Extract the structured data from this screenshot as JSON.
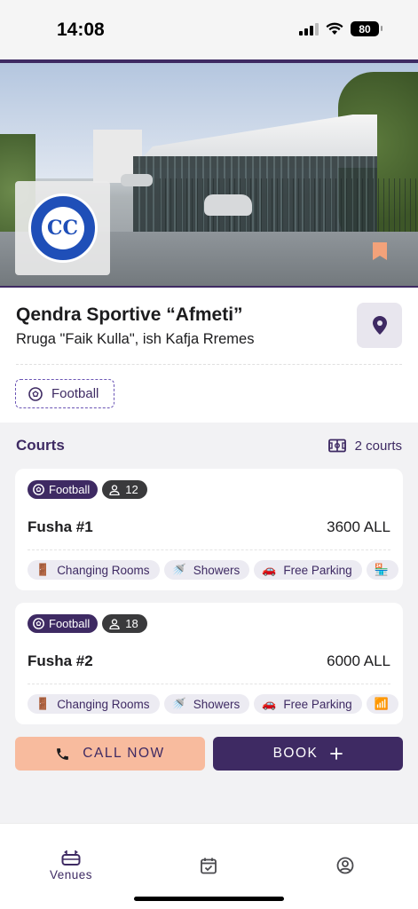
{
  "status_bar": {
    "time": "14:08",
    "battery": "80"
  },
  "venue": {
    "name": "Qendra Sportive “Afmeti”",
    "address": "Rruga \"Faik Kulla\", ish Kafja Rremes",
    "logo_text": "CC",
    "sport_chip": "Football"
  },
  "courts": {
    "title": "Courts",
    "count_label": "2 courts",
    "items": [
      {
        "sport": "Football",
        "players": "12",
        "name": "Fusha #1",
        "price": "3600 ALL",
        "amenities": [
          "Changing Rooms",
          "Showers",
          "Free Parking"
        ]
      },
      {
        "sport": "Football",
        "players": "18",
        "name": "Fusha #2",
        "price": "6000 ALL",
        "amenities": [
          "Changing Rooms",
          "Showers",
          "Free Parking"
        ]
      }
    ]
  },
  "actions": {
    "call_label": "CALL NOW",
    "book_label": "BOOK"
  },
  "nav": {
    "venues_label": "Venues"
  },
  "colors": {
    "primary": "#3e2a63",
    "accent": "#f8bb9e",
    "background": "#f2f2f4"
  }
}
